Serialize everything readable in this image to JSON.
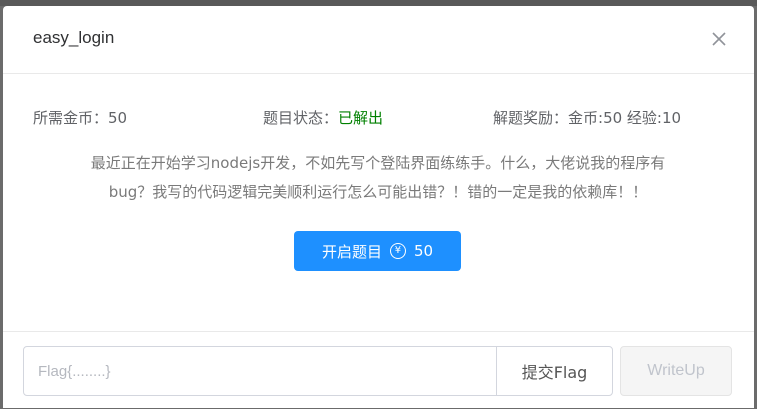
{
  "modal": {
    "title": "easy_login",
    "close_icon": "close-icon"
  },
  "info": {
    "cost_label": "所需金币：",
    "cost_value": "50",
    "status_label": "题目状态：",
    "status_value": "已解出",
    "reward_label": "解题奖励：",
    "reward_value": "金币:50 经验:10"
  },
  "description": {
    "line1": "最近正在开始学习nodejs开发，不如先写个登陆界面练练手。什么，大佬说我的程序有",
    "line2": "bug？我写的代码逻辑完美顺利运行怎么可能出错？！错的一定是我的依赖库！！"
  },
  "start_button": {
    "label": "开启题目",
    "icon": "yen-icon",
    "icon_glyph": "¥",
    "amount": "50"
  },
  "footer": {
    "flag_placeholder": "Flag{........}",
    "submit_label": "提交Flag",
    "writeup_label": "WriteUp"
  },
  "colors": {
    "primary": "#1e90ff",
    "solved": "#008000"
  }
}
